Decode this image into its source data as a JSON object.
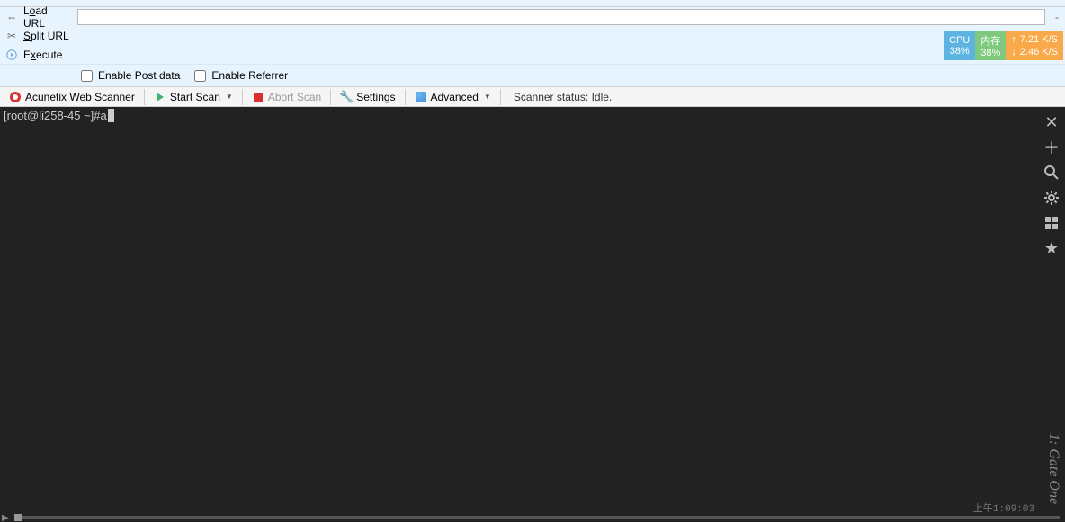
{
  "urlTools": {
    "load": "Load URL",
    "split": "Split URL",
    "execute": "Execute"
  },
  "urlInput": {
    "value": ""
  },
  "dashChar": "-",
  "monitor": {
    "cpu": {
      "label": "CPU",
      "pct": "38%"
    },
    "mem": {
      "label": "内存",
      "pct": "38%"
    },
    "net": {
      "up": "7.21 K/S",
      "down": "2.46 K/S"
    }
  },
  "options": {
    "postData": "Enable Post data",
    "referrer": "Enable Referrer"
  },
  "toolbar": {
    "acunetix": "Acunetix Web Scanner",
    "startScan": "Start Scan",
    "abortScan": "Abort Scan",
    "settings": "Settings",
    "advanced": "Advanced",
    "statusLabel": "Scanner status:",
    "statusValue": "Idle."
  },
  "terminal": {
    "prompt": "[root@li258-45 ~]# ",
    "input": "a",
    "tabLabel": "1: Gate One",
    "time": "上午1:09:03"
  }
}
